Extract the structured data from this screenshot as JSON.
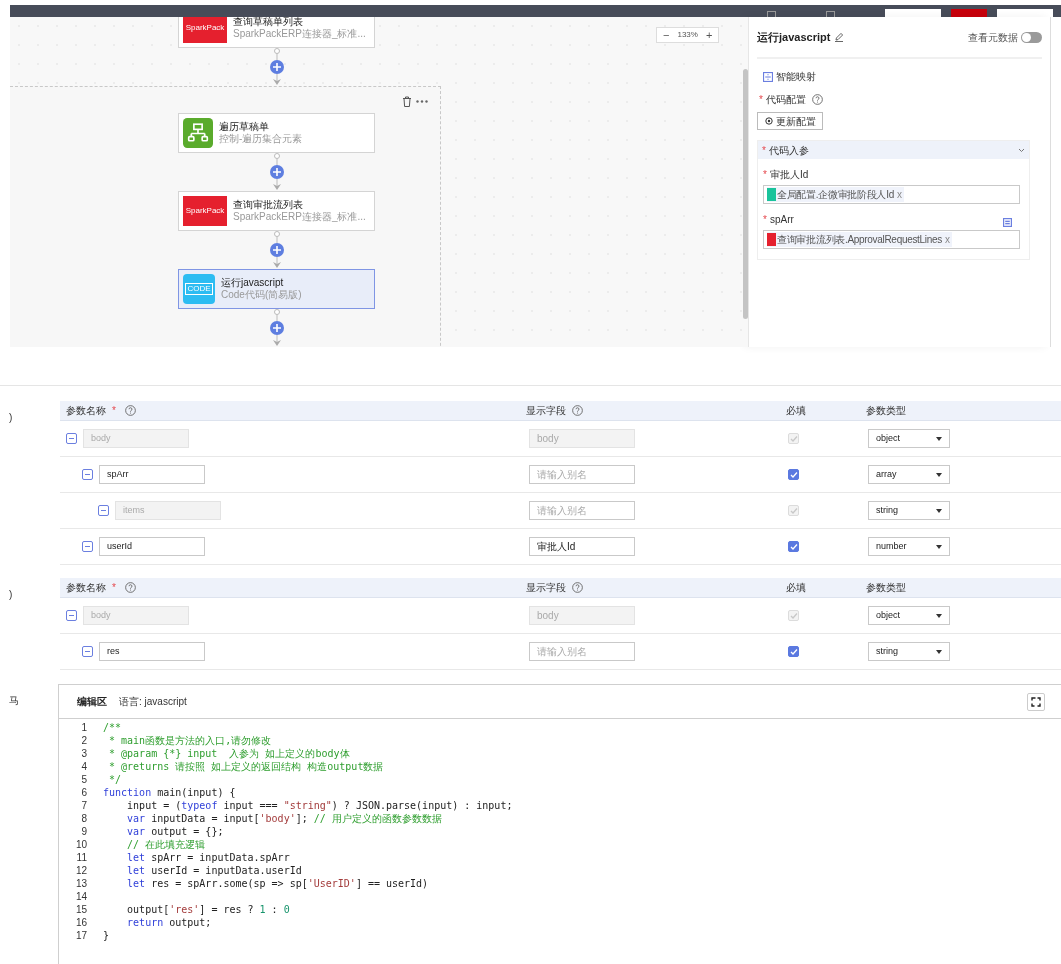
{
  "toolbar": {
    "buttons": [
      {
        "kind": "icon"
      },
      {
        "kind": "icon"
      },
      {
        "kind": "outline"
      },
      {
        "kind": "primary"
      },
      {
        "kind": "outline"
      }
    ]
  },
  "canvas": {
    "zoom": {
      "minus": "−",
      "level": "133%",
      "plus": "+"
    },
    "top_node": {
      "kind": "sparkpack",
      "logo_text": "SparkPack",
      "title": "查询草稿单列表",
      "subtitle": "SparkPackERP连接器_标准...",
      "selected": false
    },
    "group_nodes": [
      {
        "kind": "loop",
        "title": "遍历草稿单",
        "subtitle": "控制-遍历集合元素",
        "selected": false
      },
      {
        "kind": "sparkpack",
        "logo_text": "SparkPack",
        "title": "查询审批流列表",
        "subtitle": "SparkPackERP连接器_标准...",
        "selected": false
      },
      {
        "kind": "code",
        "logo_text": "CODE",
        "title": "运行javascript",
        "subtitle": "Code代码(简易版)",
        "selected": true
      }
    ]
  },
  "panel": {
    "title": "运行javascript",
    "metadata_toggle": {
      "label": "查看元数据",
      "on": false
    },
    "smart_map": "智能映射",
    "code_config": {
      "label": "代码配置",
      "required_mark": "*"
    },
    "update_button": "更新配置",
    "section": {
      "title": "代码入参",
      "required_mark": "*",
      "expanded": true,
      "fields": [
        {
          "label": "审批人Id",
          "required_mark": "*",
          "tag": {
            "color": "#19c39b",
            "text": "全局配置.企微审批阶段人Id",
            "remove": "x"
          }
        },
        {
          "label": "spArr",
          "required_mark": "*",
          "list_icon": true,
          "tag": {
            "color": "#e5202e",
            "text": "查询审批流列表.ApprovalRequestLines",
            "remove": "x"
          }
        }
      ]
    }
  },
  "margin_marks": [
    ")",
    ")",
    "马"
  ],
  "param_tables": [
    {
      "columns": [
        {
          "label": "参数名称",
          "required_mark": "*",
          "help": true
        },
        {
          "label": "显示字段",
          "help": true
        },
        {
          "label": "必填"
        },
        {
          "label": "参数类型"
        }
      ],
      "rows": [
        {
          "name": "body",
          "name_disabled": true,
          "alias": {
            "value": "body",
            "disabled": true
          },
          "required": {
            "checked": true,
            "disabled": true
          },
          "type": "object",
          "children": [
            {
              "name": "spArr",
              "name_disabled": false,
              "alias": {
                "placeholder": "请输入别名",
                "disabled": false
              },
              "required": {
                "checked": true,
                "disabled": false
              },
              "type": "array",
              "children": [
                {
                  "name": "items",
                  "name_disabled": true,
                  "alias": {
                    "placeholder": "请输入别名",
                    "disabled": false
                  },
                  "required": {
                    "checked": true,
                    "disabled": true
                  },
                  "type": "string"
                }
              ]
            },
            {
              "name": "userId",
              "name_disabled": false,
              "alias": {
                "value": "审批人Id",
                "disabled": false
              },
              "required": {
                "checked": true,
                "disabled": false
              },
              "type": "number"
            }
          ]
        }
      ]
    },
    {
      "columns": [
        {
          "label": "参数名称",
          "required_mark": "*",
          "help": true
        },
        {
          "label": "显示字段",
          "help": true
        },
        {
          "label": "必填"
        },
        {
          "label": "参数类型"
        }
      ],
      "rows": [
        {
          "name": "body",
          "name_disabled": true,
          "alias": {
            "value": "body",
            "disabled": true
          },
          "required": {
            "checked": true,
            "disabled": true
          },
          "type": "object",
          "children": [
            {
              "name": "res",
              "name_disabled": false,
              "alias": {
                "placeholder": "请输入别名",
                "disabled": false
              },
              "required": {
                "checked": true,
                "disabled": false
              },
              "type": "string"
            }
          ]
        }
      ]
    }
  ],
  "editor": {
    "title": "编辑区",
    "language": "语言: javascript",
    "lines": [
      {
        "no": "1",
        "tokens": [
          {
            "kind": "comment",
            "t": "/**"
          }
        ]
      },
      {
        "no": "2",
        "tokens": [
          {
            "kind": "comment",
            "t": " * main函数是方法的入口,请勿修改"
          }
        ]
      },
      {
        "no": "3",
        "tokens": [
          {
            "kind": "comment",
            "t": " * @param {*} input  入参为 如上定义的body体"
          }
        ]
      },
      {
        "no": "4",
        "tokens": [
          {
            "kind": "comment",
            "t": " * @returns 请按照 如上定义的返回结构 构造output数据"
          }
        ]
      },
      {
        "no": "5",
        "tokens": [
          {
            "kind": "comment",
            "t": " */"
          }
        ]
      },
      {
        "no": "6",
        "tokens": [
          {
            "kind": "keyword",
            "t": "function"
          },
          {
            "kind": "plain",
            "t": " main(input) {"
          }
        ]
      },
      {
        "no": "7",
        "tokens": [
          {
            "kind": "plain",
            "t": "    input = ("
          },
          {
            "kind": "keyword",
            "t": "typeof"
          },
          {
            "kind": "plain",
            "t": " input === "
          },
          {
            "kind": "string",
            "t": "\"string\""
          },
          {
            "kind": "plain",
            "t": ") ? JSON.parse(input) : input;"
          }
        ]
      },
      {
        "no": "8",
        "tokens": [
          {
            "kind": "keyword",
            "t": "    var"
          },
          {
            "kind": "plain",
            "t": " inputData = input["
          },
          {
            "kind": "string",
            "t": "'body'"
          },
          {
            "kind": "plain",
            "t": "]; "
          },
          {
            "kind": "comment",
            "t": "// 用户定义的函数参数数据"
          }
        ]
      },
      {
        "no": "9",
        "tokens": [
          {
            "kind": "keyword",
            "t": "    var"
          },
          {
            "kind": "plain",
            "t": " output = {};"
          }
        ]
      },
      {
        "no": "10",
        "tokens": [
          {
            "kind": "comment",
            "t": "    // 在此填充逻辑"
          }
        ]
      },
      {
        "no": "11",
        "tokens": [
          {
            "kind": "keyword",
            "t": "    let"
          },
          {
            "kind": "plain",
            "t": " spArr = inputData.spArr"
          }
        ]
      },
      {
        "no": "12",
        "tokens": [
          {
            "kind": "keyword",
            "t": "    let"
          },
          {
            "kind": "plain",
            "t": " userId = inputData.userId"
          }
        ]
      },
      {
        "no": "13",
        "tokens": [
          {
            "kind": "keyword",
            "t": "    let"
          },
          {
            "kind": "plain",
            "t": " res = spArr.some(sp => sp["
          },
          {
            "kind": "string",
            "t": "'UserID'"
          },
          {
            "kind": "plain",
            "t": "] == userId)"
          }
        ]
      },
      {
        "no": "14"
      },
      {
        "no": "15",
        "tokens": [
          {
            "kind": "plain",
            "t": "    output["
          },
          {
            "kind": "string",
            "t": "'res'"
          },
          {
            "kind": "plain",
            "t": "] = res ? "
          },
          {
            "kind": "number",
            "t": "1"
          },
          {
            "kind": "plain",
            "t": " : "
          },
          {
            "kind": "number",
            "t": "0"
          }
        ]
      },
      {
        "no": "16",
        "tokens": [
          {
            "kind": "keyword",
            "t": "    return"
          },
          {
            "kind": "plain",
            "t": " output;"
          }
        ]
      },
      {
        "no": "17",
        "tokens": [
          {
            "kind": "plain",
            "t": "}"
          }
        ]
      }
    ]
  }
}
